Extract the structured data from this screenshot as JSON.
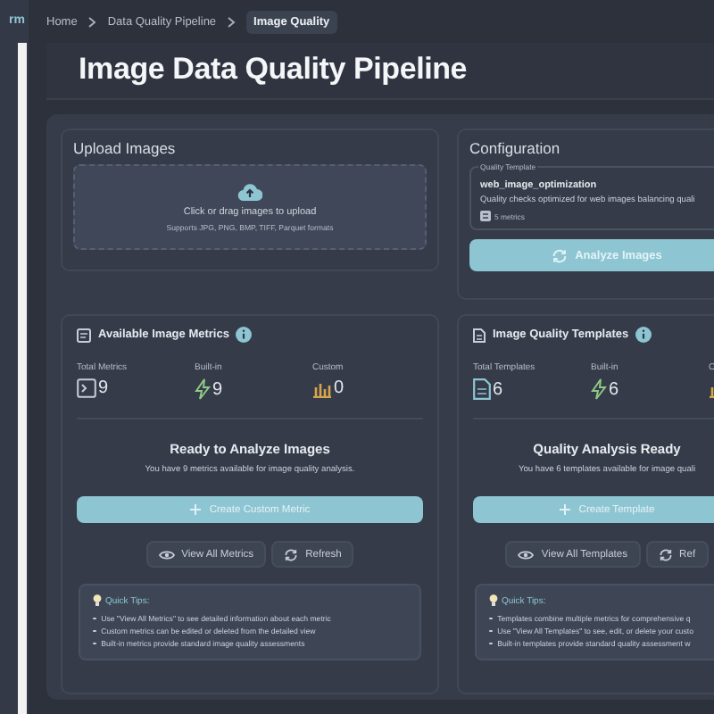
{
  "sidebar": {
    "brand": "rm"
  },
  "breadcrumb": [
    {
      "label": "Home",
      "current": false
    },
    {
      "label": "Data Quality Pipeline",
      "current": false
    },
    {
      "label": "Image Quality",
      "current": true
    }
  ],
  "page_title": "Image Data Quality Pipeline",
  "upload": {
    "title": "Upload Images",
    "prompt": "Click or drag images to upload",
    "formats": "Supports JPG, PNG, BMP, TIFF, Parquet formats"
  },
  "configuration": {
    "title": "Configuration",
    "template_legend": "Quality Template",
    "template_name": "web_image_optimization",
    "template_description": "Quality checks optimized for web images balancing quali",
    "metrics_count": "5 metrics",
    "analyze_button": "Analyze Images"
  },
  "panels": [
    {
      "title": "Available Image Metrics",
      "kind": "metrics",
      "stats": [
        {
          "label": "Total Metrics",
          "value": "9",
          "kind": "terminal"
        },
        {
          "label": "Built-in",
          "value": "9",
          "kind": "bolt"
        },
        {
          "label": "Custom",
          "value": "0",
          "kind": "chart"
        }
      ],
      "heading": "Ready to Analyze Images",
      "message": "You have 9 metrics available for image quality analysis.",
      "create_button": "Create Custom Metric",
      "view_button": "View All Metrics",
      "refresh_button": "Refresh",
      "tips_title": "Quick Tips:",
      "tips": [
        "Use \"View All Metrics\" to see detailed information about each metric",
        "Custom metrics can be edited or deleted from the detailed view",
        "Built-in metrics provide standard image quality assessments"
      ]
    },
    {
      "title": "Image Quality Templates",
      "kind": "templates",
      "stats": [
        {
          "label": "Total Templates",
          "value": "6",
          "kind": "document"
        },
        {
          "label": "Built-in",
          "value": "6",
          "kind": "bolt"
        },
        {
          "label": "C",
          "kind": "chart"
        }
      ],
      "heading": "Quality Analysis Ready",
      "message": "You have 6 templates available for image quali",
      "create_button": "Create Template",
      "view_button": "View All Templates",
      "refresh_button": "Ref",
      "tips_title": "Quick Tips:",
      "tips": [
        "Templates combine multiple metrics for comprehensive q",
        "Use \"View All Templates\" to see, edit, or delete your custo",
        "Built-in templates provide standard quality assessment w"
      ]
    }
  ]
}
